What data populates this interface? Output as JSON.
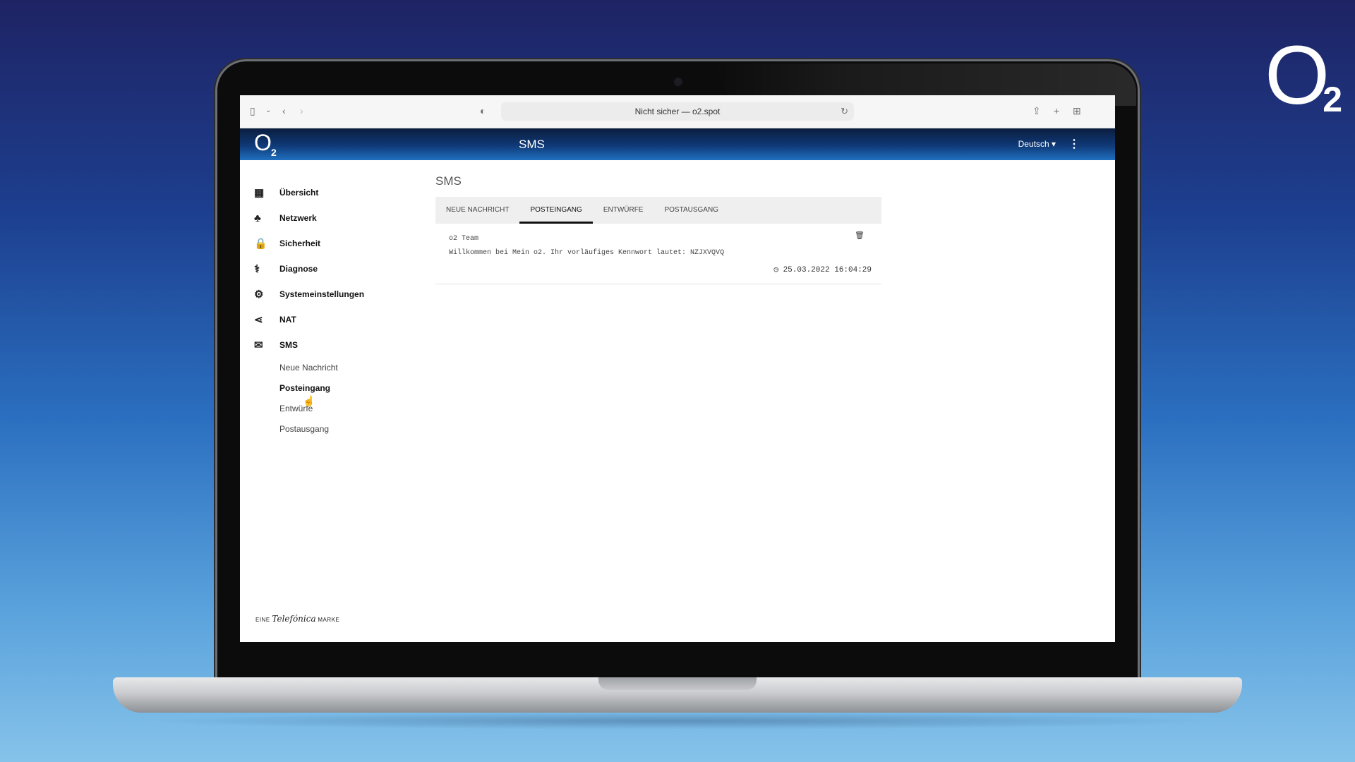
{
  "corner_logo": {
    "main": "O",
    "sub": "2"
  },
  "browser": {
    "address": "Nicht sicher — o2.spot",
    "icons": {
      "sidebar": "sidebar-icon",
      "back": "chevron-left-icon",
      "forward": "chevron-right-icon",
      "shield": "shield-icon",
      "reload": "reload-icon",
      "share": "share-icon",
      "new_tab": "plus-icon",
      "tabs": "tab-grid-icon"
    }
  },
  "header": {
    "logo_main": "O",
    "logo_sub": "2",
    "title": "SMS",
    "language": "Deutsch ▾",
    "menu": "⋮"
  },
  "sidebar": {
    "items": [
      {
        "label": "Übersicht",
        "icon": "▦"
      },
      {
        "label": "Netzwerk",
        "icon": "♣"
      },
      {
        "label": "Sicherheit",
        "icon": "🔒"
      },
      {
        "label": "Diagnose",
        "icon": "⚕"
      },
      {
        "label": "Systemeinstellungen",
        "icon": "⚙"
      },
      {
        "label": "NAT",
        "icon": "⋖"
      },
      {
        "label": "SMS",
        "icon": "✉"
      }
    ],
    "sms_sub": [
      "Neue Nachricht",
      "Posteingang",
      "Entwürfe",
      "Postausgang"
    ]
  },
  "footer": {
    "pre": "EINE",
    "brand": "Telefónica",
    "post": "MARKE"
  },
  "content": {
    "title": "SMS",
    "tabs": [
      "NEUE NACHRICHT",
      "POSTEINGANG",
      "ENTWÜRFE",
      "POSTAUSGANG"
    ],
    "active_tab": "POSTEINGANG",
    "messages": [
      {
        "sender": "o2 Team",
        "text": "Willkommen bei Mein o2. Ihr vorläufiges Kennwort lautet: NZJXVQVQ",
        "time": "25.03.2022 16:04:29"
      }
    ]
  }
}
